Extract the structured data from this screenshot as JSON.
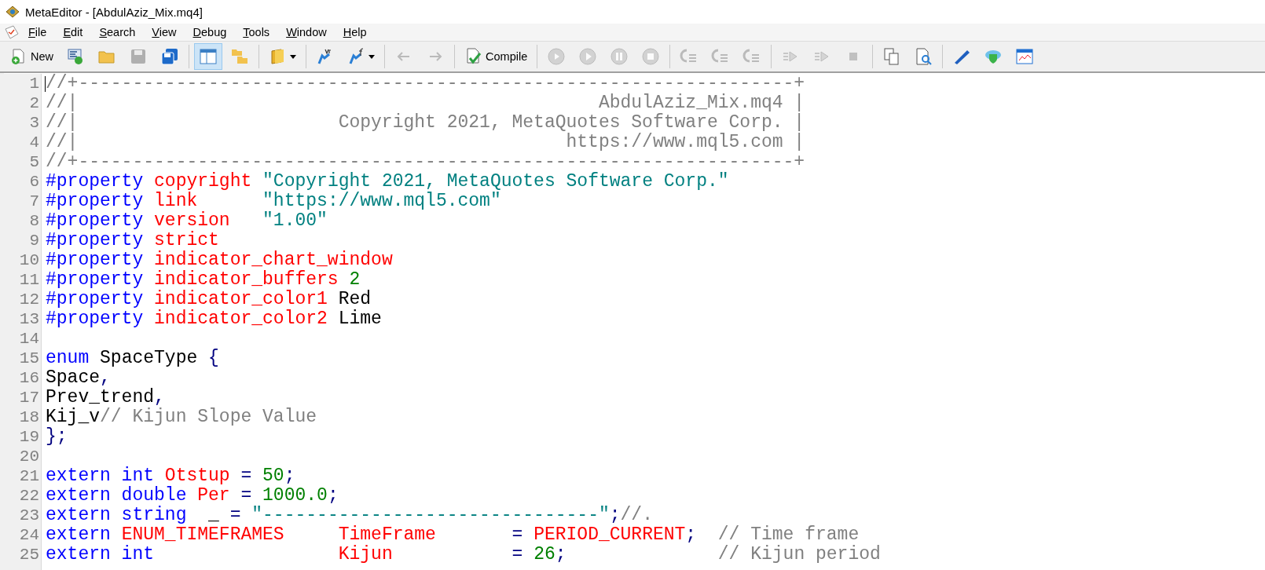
{
  "window": {
    "title": "MetaEditor - [AbdulAziz_Mix.mq4]"
  },
  "menu": [
    "File",
    "Edit",
    "Search",
    "View",
    "Debug",
    "Tools",
    "Window",
    "Help"
  ],
  "toolbar": [
    [
      {
        "label": "New",
        "disabled": false,
        "selected": false
      },
      {
        "disabled": false,
        "selected": false
      },
      {
        "disabled": false,
        "selected": false
      },
      {
        "disabled": true,
        "selected": false
      },
      {
        "disabled": false,
        "selected": false
      }
    ],
    [
      {
        "disabled": false,
        "selected": true
      },
      {
        "disabled": false,
        "selected": false
      }
    ],
    [
      {
        "disabled": false,
        "selected": false,
        "dropdown": true
      }
    ],
    [
      {
        "disabled": false,
        "selected": false
      },
      {
        "disabled": false,
        "selected": false,
        "dropdown": true
      }
    ],
    [
      {
        "disabled": true,
        "selected": false
      },
      {
        "disabled": true,
        "selected": false
      }
    ],
    [
      {
        "label": "Compile",
        "disabled": false,
        "selected": false
      }
    ],
    [
      {
        "disabled": true,
        "selected": false
      },
      {
        "disabled": true,
        "selected": false
      },
      {
        "disabled": true,
        "selected": false
      },
      {
        "disabled": true,
        "selected": false
      }
    ],
    [
      {
        "disabled": true,
        "selected": false
      },
      {
        "disabled": true,
        "selected": false
      },
      {
        "disabled": true,
        "selected": false
      }
    ],
    [
      {
        "disabled": true,
        "selected": false
      },
      {
        "disabled": true,
        "selected": false
      },
      {
        "disabled": true,
        "selected": false
      }
    ],
    [
      {
        "disabled": false,
        "selected": false
      },
      {
        "disabled": false,
        "selected": false
      }
    ],
    [
      {
        "disabled": false,
        "selected": false
      },
      {
        "disabled": false,
        "selected": false
      },
      {
        "disabled": false,
        "selected": false
      }
    ]
  ],
  "editor": {
    "lines": [
      {
        "number": "1",
        "tokens": [
          {
            "kind": "comment",
            "text": "//+------------------------------------------------------------------+"
          }
        ]
      },
      {
        "number": "2",
        "tokens": [
          {
            "kind": "comment",
            "text": "//|                                                AbdulAziz_Mix.mq4 |"
          }
        ]
      },
      {
        "number": "3",
        "tokens": [
          {
            "kind": "comment",
            "text": "//|                        Copyright 2021, MetaQuotes Software Corp. |"
          }
        ]
      },
      {
        "number": "4",
        "tokens": [
          {
            "kind": "comment",
            "text": "//|                                             https://www.mql5.com |"
          }
        ]
      },
      {
        "number": "5",
        "tokens": [
          {
            "kind": "comment",
            "text": "//+------------------------------------------------------------------+"
          }
        ]
      },
      {
        "number": "6",
        "tokens": [
          {
            "kind": "keyword",
            "text": "#property "
          },
          {
            "kind": "name",
            "text": "copyright "
          },
          {
            "kind": "string",
            "text": "\"Copyright 2021, MetaQuotes Software Corp.\""
          }
        ]
      },
      {
        "number": "7",
        "tokens": [
          {
            "kind": "keyword",
            "text": "#property "
          },
          {
            "kind": "name",
            "text": "link      "
          },
          {
            "kind": "string",
            "text": "\"https://www.mql5.com\""
          }
        ]
      },
      {
        "number": "8",
        "tokens": [
          {
            "kind": "keyword",
            "text": "#property "
          },
          {
            "kind": "name",
            "text": "version   "
          },
          {
            "kind": "string",
            "text": "\"1.00\""
          }
        ]
      },
      {
        "number": "9",
        "tokens": [
          {
            "kind": "keyword",
            "text": "#property "
          },
          {
            "kind": "name",
            "text": "strict"
          }
        ]
      },
      {
        "number": "10",
        "tokens": [
          {
            "kind": "keyword",
            "text": "#property "
          },
          {
            "kind": "name",
            "text": "indicator_chart_window"
          }
        ]
      },
      {
        "number": "11",
        "tokens": [
          {
            "kind": "keyword",
            "text": "#property "
          },
          {
            "kind": "name",
            "text": "indicator_buffers "
          },
          {
            "kind": "number",
            "text": "2"
          }
        ]
      },
      {
        "number": "12",
        "tokens": [
          {
            "kind": "keyword",
            "text": "#property "
          },
          {
            "kind": "name",
            "text": "indicator_color1"
          },
          {
            "kind": "plain",
            "text": " Red"
          }
        ]
      },
      {
        "number": "13",
        "tokens": [
          {
            "kind": "keyword",
            "text": "#property "
          },
          {
            "kind": "name",
            "text": "indicator_color2"
          },
          {
            "kind": "plain",
            "text": " Lime"
          }
        ]
      },
      {
        "number": "14"
      },
      {
        "number": "15",
        "tokens": [
          {
            "kind": "keyword",
            "text": "enum"
          },
          {
            "kind": "plain",
            "text": " SpaceType "
          },
          {
            "kind": "operator",
            "text": "{"
          }
        ]
      },
      {
        "number": "16",
        "tokens": [
          {
            "kind": "plain",
            "text": "Space"
          },
          {
            "kind": "operator",
            "text": ","
          }
        ]
      },
      {
        "number": "17",
        "tokens": [
          {
            "kind": "plain",
            "text": "Prev_trend"
          },
          {
            "kind": "operator",
            "text": ","
          }
        ]
      },
      {
        "number": "18",
        "tokens": [
          {
            "kind": "plain",
            "text": "Kij_v"
          },
          {
            "kind": "comment",
            "text": "// Kijun Slope Value"
          }
        ]
      },
      {
        "number": "19",
        "tokens": [
          {
            "kind": "operator",
            "text": "};"
          }
        ]
      },
      {
        "number": "20"
      },
      {
        "number": "21",
        "tokens": [
          {
            "kind": "keyword",
            "text": "extern int "
          },
          {
            "kind": "name",
            "text": "Otstup "
          },
          {
            "kind": "operator",
            "text": "= "
          },
          {
            "kind": "number",
            "text": "50"
          },
          {
            "kind": "operator",
            "text": ";"
          }
        ]
      },
      {
        "number": "22",
        "tokens": [
          {
            "kind": "keyword",
            "text": "extern double "
          },
          {
            "kind": "name",
            "text": "Per "
          },
          {
            "kind": "operator",
            "text": "= "
          },
          {
            "kind": "number",
            "text": "1000.0"
          },
          {
            "kind": "operator",
            "text": ";"
          }
        ]
      },
      {
        "number": "23",
        "tokens": [
          {
            "kind": "keyword",
            "text": "extern string  "
          },
          {
            "kind": "plain",
            "text": "_ "
          },
          {
            "kind": "operator",
            "text": "= "
          },
          {
            "kind": "string",
            "text": "\"-------------------------------\""
          },
          {
            "kind": "operator",
            "text": ";"
          },
          {
            "kind": "comment",
            "text": "//."
          }
        ]
      },
      {
        "number": "24",
        "tokens": [
          {
            "kind": "keyword",
            "text": "extern "
          },
          {
            "kind": "name",
            "text": "ENUM_TIMEFRAMES     "
          },
          {
            "kind": "name",
            "text": "TimeFrame       "
          },
          {
            "kind": "operator",
            "text": "= "
          },
          {
            "kind": "name",
            "text": "PERIOD_CURRENT"
          },
          {
            "kind": "operator",
            "text": ";  "
          },
          {
            "kind": "comment",
            "text": "// Time frame"
          }
        ]
      },
      {
        "number": "25",
        "tokens": [
          {
            "kind": "keyword",
            "text": "extern int                 "
          },
          {
            "kind": "name",
            "text": "Kijun           "
          },
          {
            "kind": "operator",
            "text": "= "
          },
          {
            "kind": "number",
            "text": "26"
          },
          {
            "kind": "operator",
            "text": ";              "
          },
          {
            "kind": "comment",
            "text": "// Kijun period"
          }
        ]
      }
    ]
  }
}
